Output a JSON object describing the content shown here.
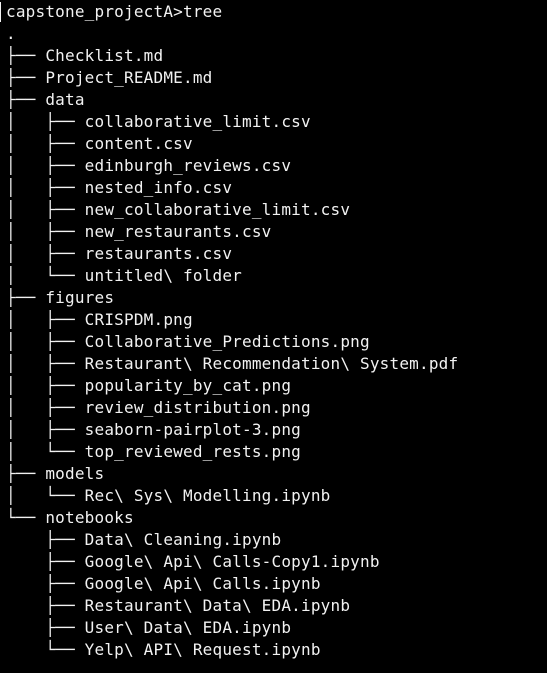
{
  "terminal": {
    "prompt": "capstone_projectA>tree",
    "root": ".",
    "entries": [
      {
        "branch": "├── ",
        "name": "Checklist.md"
      },
      {
        "branch": "├── ",
        "name": "Project_README.md"
      },
      {
        "branch": "├── ",
        "name": "data"
      },
      {
        "branch": "│   ├── ",
        "name": "collaborative_limit.csv"
      },
      {
        "branch": "│   ├── ",
        "name": "content.csv"
      },
      {
        "branch": "│   ├── ",
        "name": "edinburgh_reviews.csv"
      },
      {
        "branch": "│   ├── ",
        "name": "nested_info.csv"
      },
      {
        "branch": "│   ├── ",
        "name": "new_collaborative_limit.csv"
      },
      {
        "branch": "│   ├── ",
        "name": "new_restaurants.csv"
      },
      {
        "branch": "│   ├── ",
        "name": "restaurants.csv"
      },
      {
        "branch": "│   └── ",
        "name": "untitled\\ folder"
      },
      {
        "branch": "├── ",
        "name": "figures"
      },
      {
        "branch": "│   ├── ",
        "name": "CRISPDM.png"
      },
      {
        "branch": "│   ├── ",
        "name": "Collaborative_Predictions.png"
      },
      {
        "branch": "│   ├── ",
        "name": "Restaurant\\ Recommendation\\ System.pdf"
      },
      {
        "branch": "│   ├── ",
        "name": "popularity_by_cat.png"
      },
      {
        "branch": "│   ├── ",
        "name": "review_distribution.png"
      },
      {
        "branch": "│   ├── ",
        "name": "seaborn-pairplot-3.png"
      },
      {
        "branch": "│   └── ",
        "name": "top_reviewed_rests.png"
      },
      {
        "branch": "├── ",
        "name": "models"
      },
      {
        "branch": "│   └── ",
        "name": "Rec\\ Sys\\ Modelling.ipynb"
      },
      {
        "branch": "└── ",
        "name": "notebooks"
      },
      {
        "branch": "    ├── ",
        "name": "Data\\ Cleaning.ipynb"
      },
      {
        "branch": "    ├── ",
        "name": "Google\\ Api\\ Calls-Copy1.ipynb"
      },
      {
        "branch": "    ├── ",
        "name": "Google\\ Api\\ Calls.ipynb"
      },
      {
        "branch": "    ├── ",
        "name": "Restaurant\\ Data\\ EDA.ipynb"
      },
      {
        "branch": "    ├── ",
        "name": "User\\ Data\\ EDA.ipynb"
      },
      {
        "branch": "    └── ",
        "name": "Yelp\\ API\\ Request.ipynb"
      }
    ]
  },
  "colors": {
    "background": "#000000",
    "text": "#f2f2f2"
  }
}
